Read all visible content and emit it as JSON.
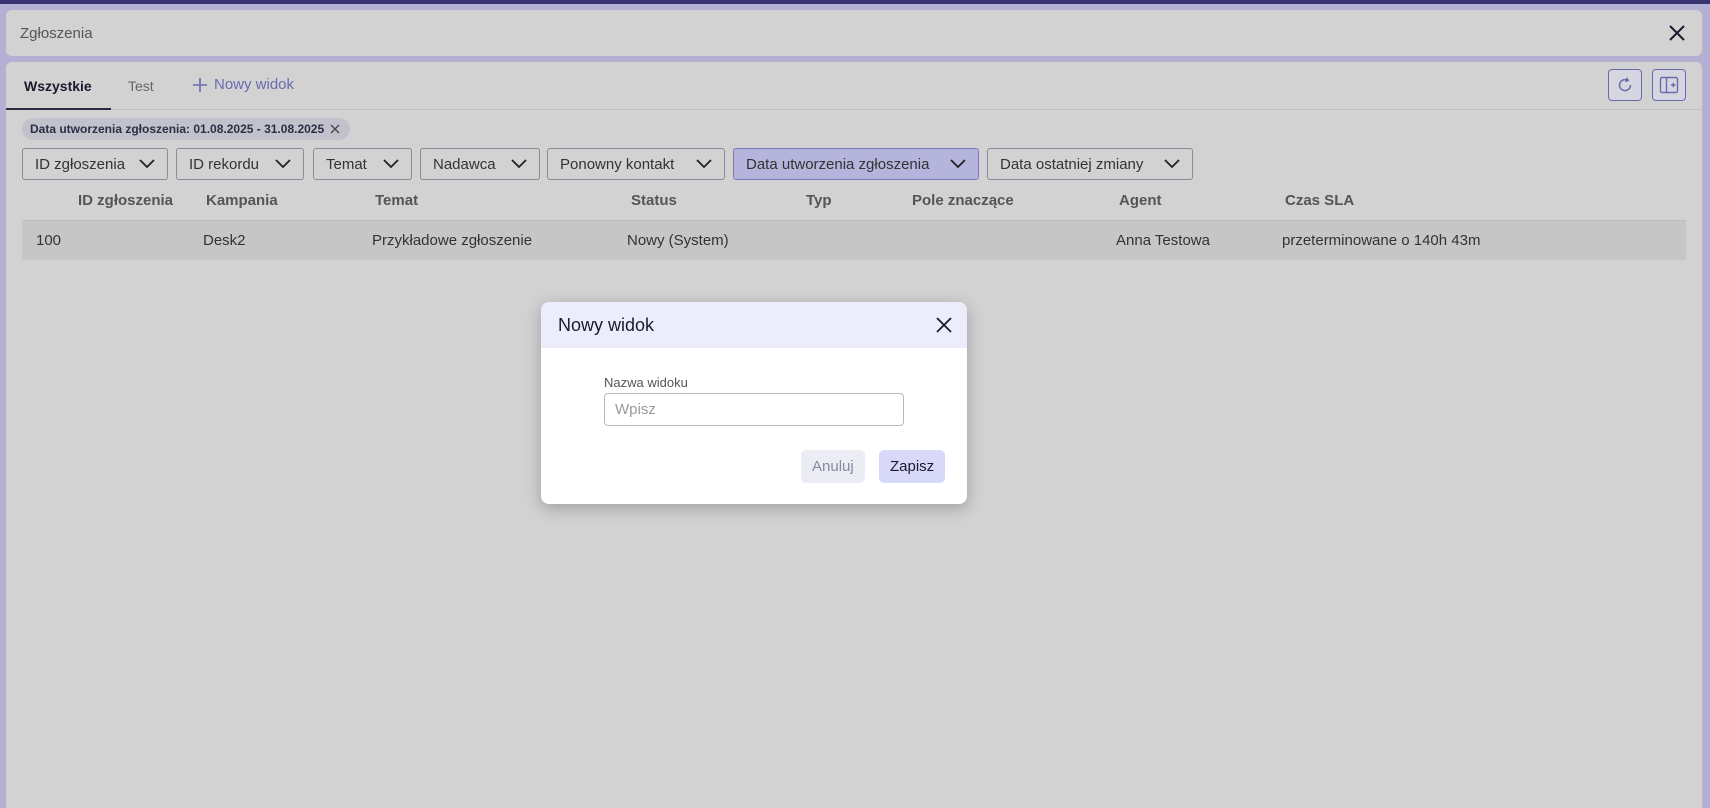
{
  "window": {
    "title": "Zgłoszenia",
    "close_icon": "close-icon"
  },
  "tabs": [
    {
      "label": "Wszystkie",
      "active": true
    },
    {
      "label": "Test",
      "active": false
    }
  ],
  "new_view_tab": {
    "label": "Nowy widok",
    "icon": "plus-icon"
  },
  "toolbar": {
    "refresh_icon": "refresh-icon",
    "columns_icon": "column-layout-icon"
  },
  "active_filter_chip": {
    "label": "Data utworzenia zgłoszenia: 01.08.2025 - 31.08.2025"
  },
  "filters": [
    {
      "label": "ID zgłoszenia",
      "active": false
    },
    {
      "label": "ID rekordu",
      "active": false
    },
    {
      "label": "Temat",
      "active": false
    },
    {
      "label": "Nadawca",
      "active": false
    },
    {
      "label": "Ponowny kontakt",
      "active": false
    },
    {
      "label": "Data utworzenia zgłoszenia",
      "active": true
    },
    {
      "label": "Data ostatniej zmiany",
      "active": false
    }
  ],
  "table": {
    "columns": [
      "ID zgłoszenia",
      "Kampania",
      "Temat",
      "Status",
      "Typ",
      "Pole znaczące",
      "Agent",
      "Czas SLA"
    ],
    "rows": [
      [
        "100",
        "Desk2",
        "Przykładowe zgłoszenie",
        "Nowy (System)",
        "",
        "",
        "Anna Testowa",
        "przeterminowane o 140h 43m"
      ]
    ]
  },
  "modal": {
    "title": "Nowy widok",
    "field_label": "Nazwa widoku",
    "field_value": "",
    "field_placeholder": "Wpisz",
    "cancel_label": "Anuluj",
    "save_label": "Zapisz"
  },
  "colors": {
    "accent": "#6a6ab0",
    "active_filter_bg": "#b4b4dc",
    "modal_header_bg": "#ececfb"
  }
}
